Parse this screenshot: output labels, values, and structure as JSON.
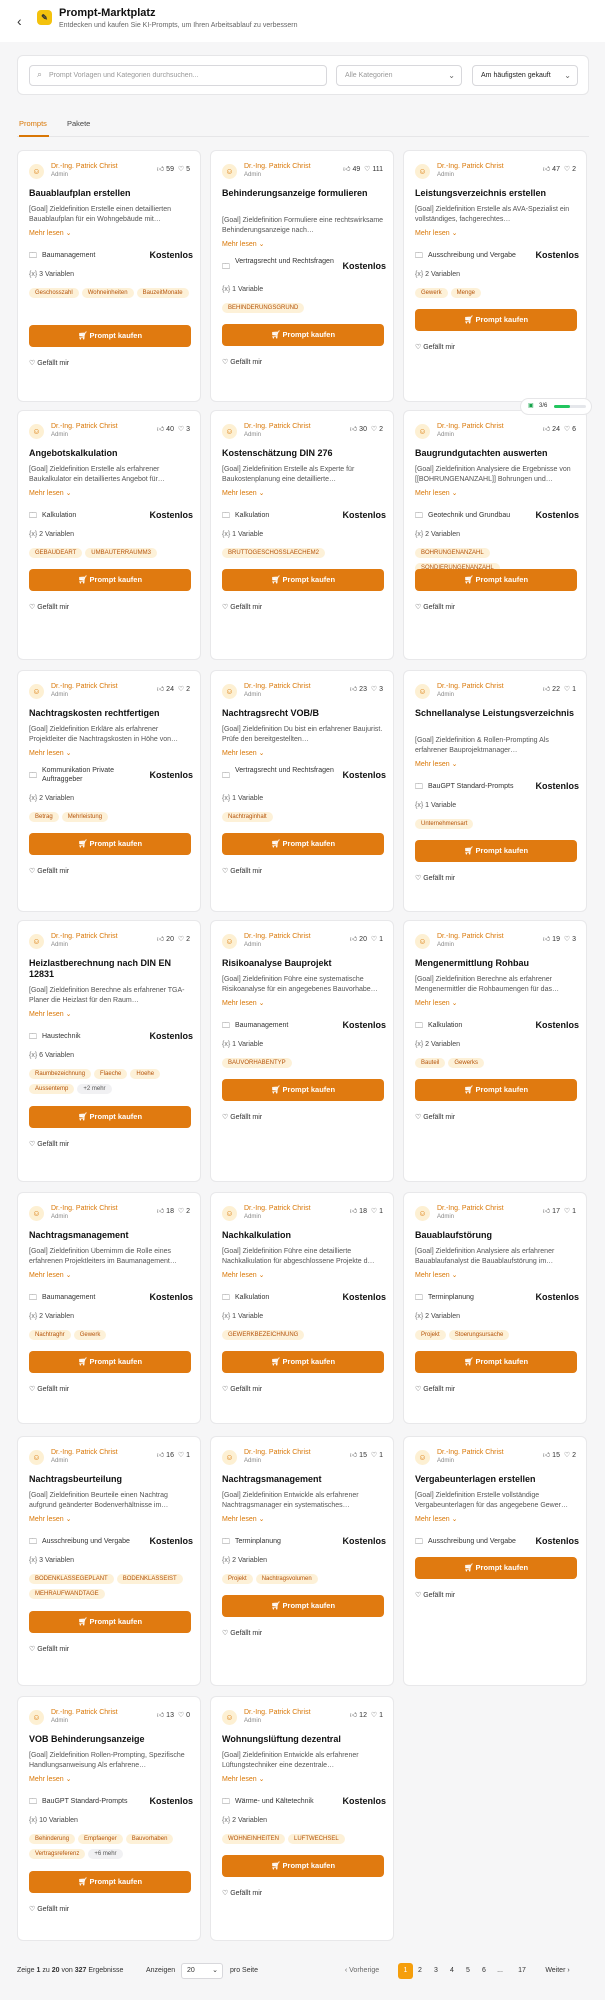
{
  "header": {
    "back_icon": "‹",
    "logo_text": "✎",
    "title": "Prompt-Marktplatz",
    "subtitle": "Entdecken und kaufen Sie KI-Prompts, um Ihren Arbeitsablauf zu verbessern"
  },
  "filters": {
    "search_placeholder": "Prompt Vorlagen und Kategorien durchsuchen...",
    "category_select": "Alle Kategorien",
    "sort_select": "Am häufigsten gekauft"
  },
  "tabs": [
    {
      "label": "Prompts",
      "active": true
    },
    {
      "label": "Pakete",
      "active": false
    }
  ],
  "common": {
    "author": "Dr.-Ing. Patrick Christ",
    "role": "Admin",
    "more": "Mehr lesen ⌄",
    "price": "Kostenlos",
    "buy_label": "Prompt kaufen",
    "like_label": "Gefällt mir"
  },
  "progress": {
    "text": "3/6",
    "value": 0.5
  },
  "cards": [
    {
      "title": "Bauablaufplan erstellen",
      "likes": "59",
      "comments": "5",
      "desc": "[Goal] Zieldefinition Erstelle einen detaillierten Bauablaufplan für ein Wohngebäude mit…",
      "category": "Baumanagement",
      "variables": "3 Variablen",
      "tags": [
        "Geschosszahl",
        "Wohneinheiten",
        "BauzeitMonate"
      ]
    },
    {
      "title": "Behinderungsanzeige formulieren",
      "likes": "49",
      "comments": "111",
      "desc": "[Goal] Zieldefinition Formuliere eine rechtswirksame Behinderungsanzeige nach…",
      "category": "Vertragsrecht und Rechtsfragen",
      "variables": "1 Variable",
      "tags": [
        "BEHINDERUNGSGRUND"
      ]
    },
    {
      "title": "Leistungsverzeichnis erstellen",
      "likes": "47",
      "comments": "2",
      "desc": "[Goal] Zieldefinition Erstelle als AVA-Spezialist ein vollständiges, fachgerechtes…",
      "category": "Ausschreibung und Vergabe",
      "variables": "2 Variablen",
      "tags": [
        "Gewerk",
        "Menge"
      ]
    },
    {
      "title": "Angebotskalkulation",
      "likes": "40",
      "comments": "3",
      "desc": "[Goal] Zieldefinition Erstelle als erfahrener Baukalkulator ein detailliertes Angebot für…",
      "category": "Kalkulation",
      "variables": "2 Variablen",
      "tags": [
        "GEBAUDEART",
        "UMBAUTERRAUMM3"
      ]
    },
    {
      "title": "Kostenschätzung DIN 276",
      "likes": "30",
      "comments": "2",
      "desc": "[Goal] Zieldefinition Erstelle als Experte für Baukostenplanung eine detaillierte…",
      "category": "Kalkulation",
      "variables": "1 Variable",
      "tags": [
        "BRUTTOGESCHOSSLAECHEM2"
      ]
    },
    {
      "title": "Baugrundgutachten auswerten",
      "likes": "24",
      "comments": "6",
      "desc": "[Goal] Zieldefinition Analysiere die Ergebnisse von [[BOHRUNGENANZAHL]] Bohrungen und…",
      "category": "Geotechnik und Grundbau",
      "variables": "2 Variablen",
      "tags": [
        "BOHRUNGENANZAHL",
        "SONDIERUNGENANZAHL"
      ]
    },
    {
      "title": "Nachtragskosten rechtfertigen",
      "likes": "24",
      "comments": "2",
      "desc": "[Goal] Zieldefinition Erkläre als erfahrener Projektleiter die Nachtragskosten in Höhe von…",
      "category": "Kommunikation Private Auftraggeber",
      "variables": "2 Variablen",
      "tags": [
        "Betrag",
        "Mehrleistung"
      ]
    },
    {
      "title": "Nachtragsrecht VOB/B",
      "likes": "23",
      "comments": "3",
      "desc": "[Goal] Zieldefinition Du bist ein erfahrener Baujurist. Prüfe den bereitgestellten…",
      "category": "Vertragsrecht und Rechtsfragen",
      "variables": "1 Variable",
      "tags": [
        "Nachtraginhalt"
      ]
    },
    {
      "title": "Schnellanalyse Leistungsverzeichnis",
      "likes": "22",
      "comments": "1",
      "desc": "[Goal] Zieldefinition & Rollen-Prompting Als erfahrener Bauprojektmanager…",
      "category": "BauGPT Standard-Prompts",
      "variables": "1 Variable",
      "tags": [
        "Unternehmensart"
      ]
    },
    {
      "title": "Heizlastberechnung nach DIN EN 12831",
      "likes": "20",
      "comments": "2",
      "desc": "[Goal] Zieldefinition Berechne als erfahrener TGA-Planer die Heizlast für den Raum…",
      "category": "Haustechnik",
      "variables": "6 Variablen",
      "tags": [
        "Raumbezeichnung",
        "Flaeche",
        "Hoehe",
        "Aussentemp",
        "+2 mehr"
      ]
    },
    {
      "title": "Risikoanalyse Bauprojekt",
      "likes": "20",
      "comments": "1",
      "desc": "[Goal] Zieldefinition Führe eine systematische Risikoanalyse für ein angegebenes Bauvorhabe…",
      "category": "Baumanagement",
      "variables": "1 Variable",
      "tags": [
        "BAUVORHABENTYP"
      ]
    },
    {
      "title": "Mengenermittlung Rohbau",
      "likes": "19",
      "comments": "3",
      "desc": "[Goal] Zieldefinition Berechne als erfahrener Mengenermittler die Rohbaumengen für das…",
      "category": "Kalkulation",
      "variables": "2 Variablen",
      "tags": [
        "Bauteil",
        "Gewerks"
      ]
    },
    {
      "title": "Nachtragsmanagement",
      "likes": "18",
      "comments": "2",
      "desc": "[Goal] Zieldefinition Übernimm die Rolle eines erfahrenen Projektleiters im Baumanagement…",
      "category": "Baumanagement",
      "variables": "2 Variablen",
      "tags": [
        "Nachtraghr",
        "Gewerk"
      ]
    },
    {
      "title": "Nachkalkulation",
      "likes": "18",
      "comments": "1",
      "desc": "[Goal] Zieldefinition Führe eine detaillierte Nachkalkulation für abgeschlossene Projekte d…",
      "category": "Kalkulation",
      "variables": "1 Variable",
      "tags": [
        "GEWERKBEZEICHNUNG"
      ]
    },
    {
      "title": "Bauablaufstörung",
      "likes": "17",
      "comments": "1",
      "desc": "[Goal] Zieldefinition Analysiere als erfahrener Bauablaufanalyst die Bauablaufstörung im…",
      "category": "Terminplanung",
      "variables": "2 Variablen",
      "tags": [
        "Projekt",
        "Stoerungsursache"
      ]
    },
    {
      "title": "Nachtragsbeurteilung",
      "likes": "16",
      "comments": "1",
      "desc": "[Goal] Zieldefinition Beurteile einen Nachtrag aufgrund geänderter Bodenverhältnisse im…",
      "category": "Ausschreibung und Vergabe",
      "variables": "3 Variablen",
      "tags": [
        "BODENKLASSEGEPLANT",
        "BODENKLASSEIST",
        "MEHRAUFWANDTAGE"
      ]
    },
    {
      "title": "Nachtragsmanagement",
      "likes": "15",
      "comments": "1",
      "desc": "[Goal] Zieldefinition Entwickle als erfahrener Nachtragsmanager ein systematisches…",
      "category": "Terminplanung",
      "variables": "2 Variablen",
      "tags": [
        "Projekt",
        "Nachtragsvolumen"
      ]
    },
    {
      "title": "Vergabeunterlagen erstellen",
      "likes": "15",
      "comments": "2",
      "desc": "[Goal] Zieldefinition Erstelle vollständige Vergabeunterlagen für das angegebene Gewer…",
      "category": "Ausschreibung und Vergabe",
      "variables": "",
      "tags": []
    },
    {
      "title": "VOB Behinderungsanzeige",
      "likes": "13",
      "comments": "0",
      "desc": "[Goal] Zieldefinition Rollen-Prompting, Spezifische Handlungsanweisung Als erfahrene…",
      "category": "BauGPT Standard-Prompts",
      "variables": "10 Variablen",
      "tags": [
        "Behinderung",
        "Empfaenger",
        "Bauvorhaben",
        "Vertragsreferenz",
        "+6 mehr"
      ]
    },
    {
      "title": "Wohnungslüftung dezentral",
      "likes": "12",
      "comments": "1",
      "desc": "[Goal] Zieldefinition Entwickle als erfahrener Lüftungstechniker eine dezentrale…",
      "category": "Wärme- und Kältetechnik",
      "variables": "2 Variablen",
      "tags": [
        "WOHNEINHEITEN",
        "LUFTWECHSEL"
      ]
    }
  ],
  "footer": {
    "showing_prefix": "Zeige",
    "from": "1",
    "to_word": "zu",
    "to": "20",
    "of_word": "von",
    "total": "327",
    "results_word": "Ergebnisse",
    "show_label": "Anzeigen",
    "per_page": "20",
    "per_page_suffix": "pro Seite",
    "prev": "‹  Vorherige",
    "pages": [
      "1",
      "2",
      "3",
      "4",
      "5",
      "6",
      "...",
      "17"
    ],
    "next": "Weiter  ›"
  }
}
